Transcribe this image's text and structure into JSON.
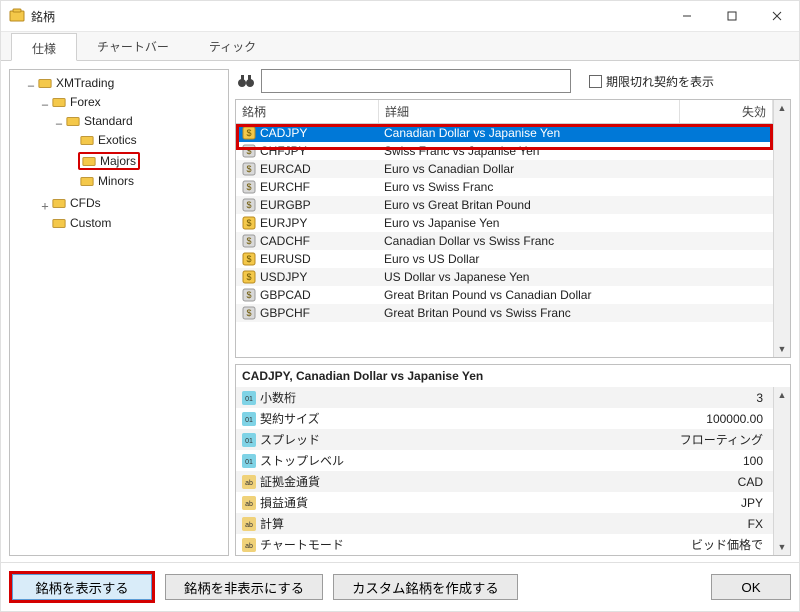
{
  "window": {
    "title": "銘柄"
  },
  "tabs": {
    "spec": "仕様",
    "chartbar": "チャートバー",
    "tick": "ティック"
  },
  "tree": {
    "root": "XMTrading",
    "forex": "Forex",
    "standard": "Standard",
    "exotics": "Exotics",
    "majors": "Majors",
    "minors": "Minors",
    "cfds": "CFDs",
    "custom": "Custom"
  },
  "search": {
    "placeholder": "",
    "expired_label": "期限切れ契約を表示"
  },
  "table": {
    "headers": {
      "symbol": "銘柄",
      "desc": "詳細",
      "invalid": "失効"
    },
    "rows": [
      {
        "sym": "CADJPY",
        "desc": "Canadian Dollar vs Japanise Yen",
        "sel": true,
        "gold": true
      },
      {
        "sym": "CHFJPY",
        "desc": "Swiss Franc vs Japanise Yen"
      },
      {
        "sym": "EURCAD",
        "desc": "Euro vs Canadian Dollar"
      },
      {
        "sym": "EURCHF",
        "desc": "Euro vs Swiss Franc"
      },
      {
        "sym": "EURGBP",
        "desc": "Euro vs Great Britan Pound"
      },
      {
        "sym": "EURJPY",
        "desc": "Euro vs Japanise Yen",
        "gold": true
      },
      {
        "sym": "CADCHF",
        "desc": "Canadian Dollar vs Swiss Franc"
      },
      {
        "sym": "EURUSD",
        "desc": "Euro vs US Dollar",
        "gold": true
      },
      {
        "sym": "USDJPY",
        "desc": "US Dollar vs Japanese Yen",
        "gold": true
      },
      {
        "sym": "GBPCAD",
        "desc": "Great Britan Pound vs Canadian Dollar"
      },
      {
        "sym": "GBPCHF",
        "desc": "Great Britan Pound vs Swiss Franc"
      }
    ]
  },
  "detail": {
    "title": "CADJPY, Canadian Dollar vs Japanise Yen",
    "items": [
      {
        "k": "小数桁",
        "v": "3",
        "t": "num"
      },
      {
        "k": "契約サイズ",
        "v": "100000.00",
        "t": "num"
      },
      {
        "k": "スプレッド",
        "v": "フローティング",
        "t": "num"
      },
      {
        "k": "ストップレベル",
        "v": "100",
        "t": "num"
      },
      {
        "k": "証拠金通貨",
        "v": "CAD",
        "t": "str"
      },
      {
        "k": "損益通貨",
        "v": "JPY",
        "t": "str"
      },
      {
        "k": "計算",
        "v": "FX",
        "t": "str"
      },
      {
        "k": "チャートモード",
        "v": "ビッド価格で",
        "t": "str"
      }
    ]
  },
  "footer": {
    "show": "銘柄を表示する",
    "hide": "銘柄を非表示にする",
    "create": "カスタム銘柄を作成する",
    "ok": "OK"
  }
}
